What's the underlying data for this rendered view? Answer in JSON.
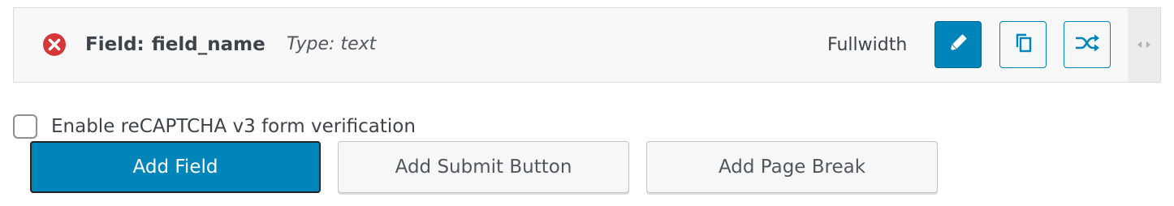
{
  "field": {
    "label_prefix": "Field:",
    "name": "field_name",
    "type_text": "Type: text",
    "fullwidth_label": "Fullwidth",
    "icons": {
      "remove": "remove-circle-icon",
      "edit": "pencil-icon",
      "duplicate": "duplicate-icon",
      "move": "shuffle-icon",
      "drag": "drag-handle-icon"
    }
  },
  "recaptcha": {
    "label": "Enable reCAPTCHA v3 form verification",
    "checked": false
  },
  "buttons": {
    "add_field": "Add Field",
    "add_submit": "Add Submit Button",
    "add_page_break": "Add Page Break"
  },
  "colors": {
    "accent": "#0085ba",
    "error": "#d63638",
    "row_bg": "#f8f8f8"
  }
}
